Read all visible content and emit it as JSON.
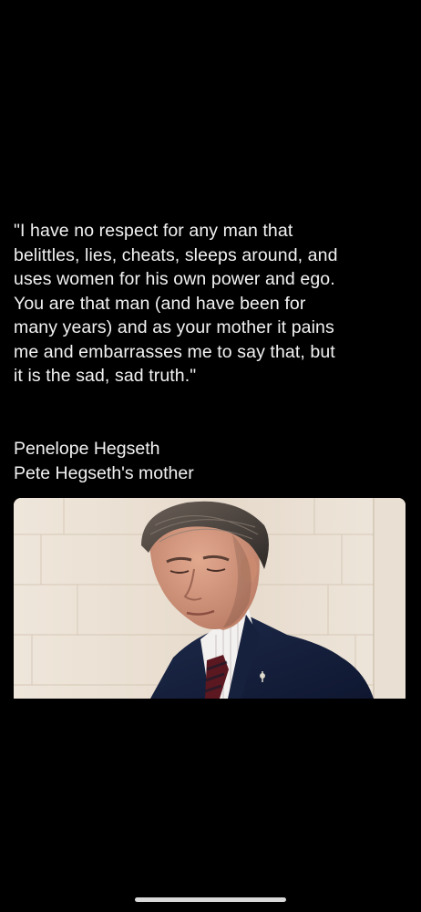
{
  "post": {
    "quote": "\"I have no respect for any man that\nbelittles, lies, cheats, sleeps around, and\nuses women for his own power and ego.\nYou are that man (and have been for\nmany years) and as your mother it pains\nme and embarrasses me to say that, but\nit is the sad, sad truth.\"",
    "author_name": "Penelope Hegseth",
    "author_description": "Pete Hegseth's mother"
  },
  "colors": {
    "background": "#000000",
    "text": "#f2f2f2",
    "home_indicator": "#d9d9d9"
  }
}
